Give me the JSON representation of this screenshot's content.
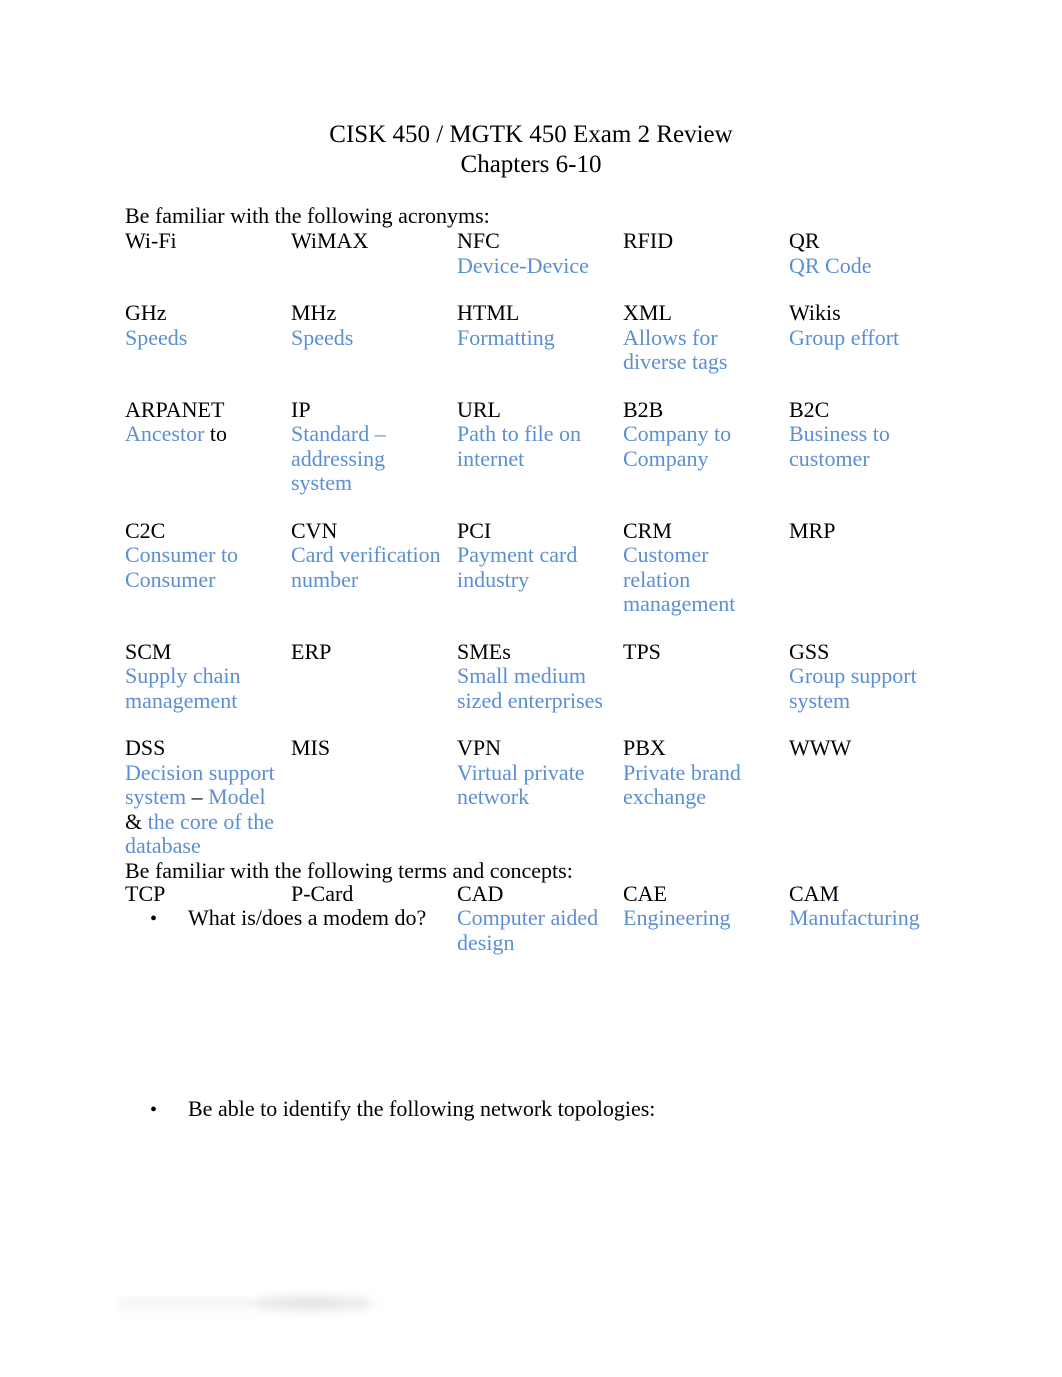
{
  "document": {
    "title_line1": "CISK 450 / MGTK 450 Exam 2 Review",
    "title_line2": "Chapters 6-10",
    "lead_acronyms": "Be familiar with the following acronyms:",
    "lead_terms": "Be familiar with the following terms and concepts:",
    "accent_color": "#5b8fd4",
    "text_color": "#000000"
  },
  "acronyms": {
    "rows": [
      {
        "cells": [
          {
            "term": "Wi-Fi",
            "def": ""
          },
          {
            "term": "WiMAX",
            "def": ""
          },
          {
            "term": "NFC",
            "def": "Device-Device"
          },
          {
            "term": "RFID",
            "def": ""
          },
          {
            "term": "QR",
            "def": "QR Code"
          }
        ]
      },
      {
        "cells": [
          {
            "term": "GHz",
            "def": "Speeds"
          },
          {
            "term": "MHz",
            "def": "Speeds"
          },
          {
            "term": "HTML",
            "def": "Formatting"
          },
          {
            "term": "XML",
            "def": "Allows for diverse tags"
          },
          {
            "term": "Wikis",
            "def": "Group effort"
          }
        ]
      },
      {
        "cells": [
          {
            "term": "ARPANET",
            "def_parts": [
              {
                "t": "Ancestor ",
                "c": "accent"
              },
              {
                "t": "to",
                "c": "black"
              }
            ]
          },
          {
            "term": "IP",
            "def": "Standard – addressing system"
          },
          {
            "term": "URL",
            "def": "Path to file on internet"
          },
          {
            "term": "B2B",
            "def": "Company to Company"
          },
          {
            "term": "B2C",
            "def": "Business to customer"
          }
        ]
      },
      {
        "cells": [
          {
            "term": "C2C",
            "def": "Consumer to Consumer"
          },
          {
            "term": "CVN",
            "def": "Card verification number"
          },
          {
            "term": "PCI",
            "def": "Payment card industry"
          },
          {
            "term": "CRM",
            "def": "Customer relation management"
          },
          {
            "term": "MRP",
            "def": ""
          }
        ]
      },
      {
        "cells": [
          {
            "term": "SCM",
            "def": "Supply chain management"
          },
          {
            "term": "ERP",
            "def": ""
          },
          {
            "term": "SMEs",
            "def": "Small medium sized enterprises"
          },
          {
            "term": "TPS",
            "def": ""
          },
          {
            "term": "GSS",
            "def": "Group support system"
          }
        ]
      },
      {
        "cells": [
          {
            "term": "DSS",
            "def_parts": [
              {
                "t": "Decision support system ",
                "c": "accent"
              },
              {
                "t": "–",
                "c": "black"
              },
              {
                "t": " Model ",
                "c": "accent"
              },
              {
                "t": "&",
                "c": "black"
              },
              {
                "t": " the core of the database",
                "c": "accent"
              }
            ]
          },
          {
            "term": "MIS",
            "def": ""
          },
          {
            "term": "VPN",
            "def": "Virtual private network"
          },
          {
            "term": "PBX",
            "def": "Private brand exchange"
          },
          {
            "term": "WWW",
            "def": ""
          }
        ]
      },
      {
        "cells": [
          {
            "term": "TCP",
            "def": ""
          },
          {
            "term": "P-Card",
            "def": ""
          },
          {
            "term": "CAD",
            "def": "Computer aided design"
          },
          {
            "term": "CAE",
            "def": "Engineering"
          },
          {
            "term": "CAM",
            "def": "Manufacturing"
          }
        ]
      }
    ]
  },
  "bullets": [
    {
      "marker": "•",
      "text": "What is/does a modem do?"
    },
    {
      "marker": "•",
      "text": "Be able to identify the following network topologies:"
    }
  ]
}
